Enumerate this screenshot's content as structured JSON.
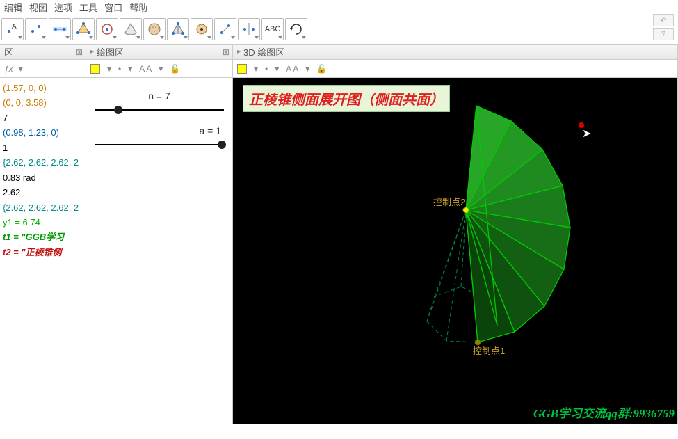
{
  "menu": {
    "edit": "编辑",
    "view": "视图",
    "options": "选项",
    "tools": "工具",
    "window": "窗口",
    "help": "帮助"
  },
  "toolbar": {
    "buttons": [
      "point-a",
      "point",
      "line",
      "polygon",
      "circle",
      "cone",
      "sphere",
      "pyramid",
      "intersect",
      "angle",
      "reflect",
      "text",
      "rotate-view"
    ],
    "text_label": "ABC"
  },
  "panels": {
    "algebra": {
      "title": "区",
      "fx": "ƒx",
      "tri": "▾"
    },
    "graph2d": {
      "title": "绘图区",
      "tri": "▸",
      "tools": {
        "aa": "A A",
        "lock": "🔓"
      }
    },
    "graph3d": {
      "title": "3D 绘图区",
      "tri": "▸",
      "tools": {
        "aa": "A A",
        "lock": "🔓"
      }
    }
  },
  "algebra_items": [
    {
      "text": "(1.57, 0, 0)",
      "color": "#cc7a00"
    },
    {
      "text": "(0, 0, 3.58)",
      "color": "#cc7a00"
    },
    {
      "text": "7",
      "color": "#000"
    },
    {
      "text": "(0.98, 1.23, 0)",
      "color": "#0060a0"
    },
    {
      "text": "1",
      "color": "#000"
    },
    {
      "text": "{2.62, 2.62, 2.62, 2",
      "color": "#008a8a"
    },
    {
      "text": "0.83 rad",
      "color": "#000"
    },
    {
      "text": "2.62",
      "color": "#000"
    },
    {
      "text": "{2.62, 2.62, 2.62, 2",
      "color": "#008a8a"
    },
    {
      "text": "y1 = 6.74",
      "color": "#00b000"
    },
    {
      "text": "t1 = \"GGB学习",
      "color": "#009a00",
      "bold": true
    },
    {
      "text": "t2 = \"正棱锥侧",
      "color": "#c01010",
      "bold": true
    }
  ],
  "sliders": {
    "n": {
      "label": "n = 7",
      "pos": 15
    },
    "a": {
      "label": "a = 1",
      "pos": 95
    }
  },
  "scene3d": {
    "title": "正棱锥侧面展开图（侧面共面）",
    "label1": "控制点1",
    "label2": "控制点2",
    "footer": "GGB学习交流qq群:9936759"
  }
}
